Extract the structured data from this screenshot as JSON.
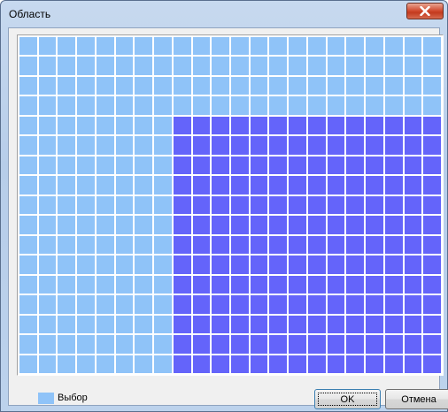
{
  "window": {
    "title": "Область",
    "close_icon": "close-x-icon"
  },
  "grid": {
    "columns": 22,
    "rows": 17,
    "selection": {
      "col_start": 8,
      "col_end": 21,
      "row_start": 4,
      "row_end": 16
    },
    "colors": {
      "cell": "#8fc3f8",
      "selected_cell": "#6464fa",
      "gridline": "#ffffff"
    }
  },
  "legend": {
    "label": "Выбор",
    "color": "#8fc3f8"
  },
  "buttons": {
    "ok_label": "OK",
    "cancel_label": "Отмена"
  }
}
